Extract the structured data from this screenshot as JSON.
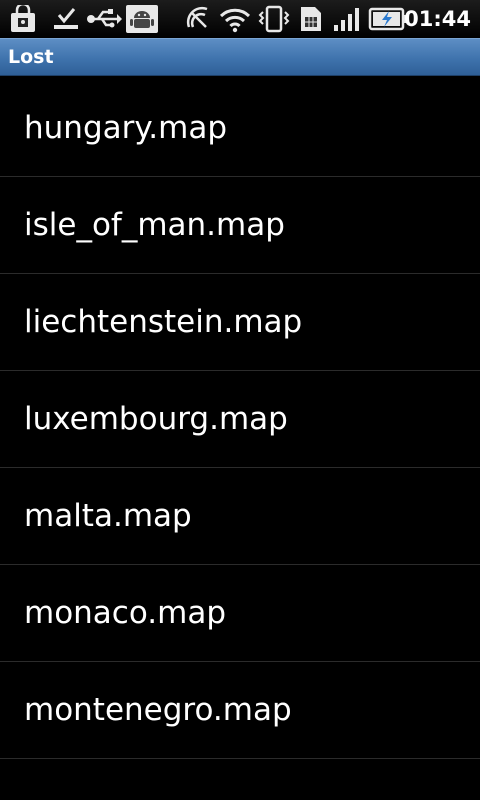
{
  "status_bar": {
    "time": "01:44",
    "icons": [
      "shopping-bag-icon",
      "download-complete-icon",
      "usb-icon",
      "android-debug-icon",
      "nfc-icon",
      "wifi-icon",
      "vibrate-icon",
      "sim-card-icon",
      "signal-icon",
      "battery-charging-icon"
    ]
  },
  "title_bar": {
    "title": "Lost"
  },
  "file_list": {
    "items": [
      {
        "label": "hungary.map"
      },
      {
        "label": "isle_of_man.map"
      },
      {
        "label": "liechtenstein.map"
      },
      {
        "label": "luxembourg.map"
      },
      {
        "label": "malta.map"
      },
      {
        "label": "monaco.map"
      },
      {
        "label": "montenegro.map"
      }
    ]
  }
}
